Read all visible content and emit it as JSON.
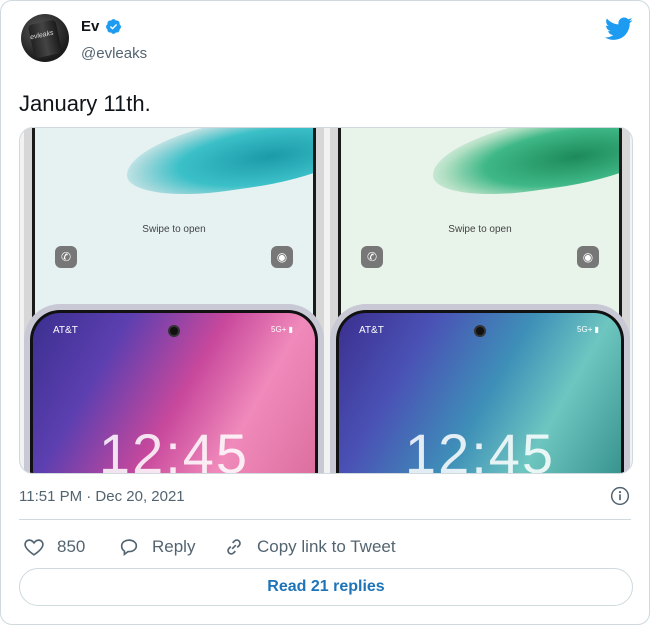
{
  "header": {
    "display_name": "Ev",
    "handle": "@evleaks",
    "avatar_text": "evleaks",
    "verified_icon": "verified-badge-icon",
    "platform_icon": "twitter-bird-icon",
    "brand_color": "#1d9bf0"
  },
  "tweet": {
    "text": "January 11th.",
    "timestamp": "11:51 PM · Dec 20, 2021"
  },
  "media": {
    "top_left": {
      "swipe_text": "Swipe to open"
    },
    "top_right": {
      "swipe_text": "Swipe to open"
    },
    "bottom_left": {
      "carrier": "AT&T",
      "status": "5G+ ▮",
      "clock": "12:45"
    },
    "bottom_right": {
      "carrier": "AT&T",
      "status": "5G+ ▮",
      "clock": "12:45"
    }
  },
  "actions": {
    "likes_count": "850",
    "reply_label": "Reply",
    "copy_label": "Copy link to Tweet"
  },
  "footer": {
    "read_replies_label": "Read 21 replies"
  }
}
